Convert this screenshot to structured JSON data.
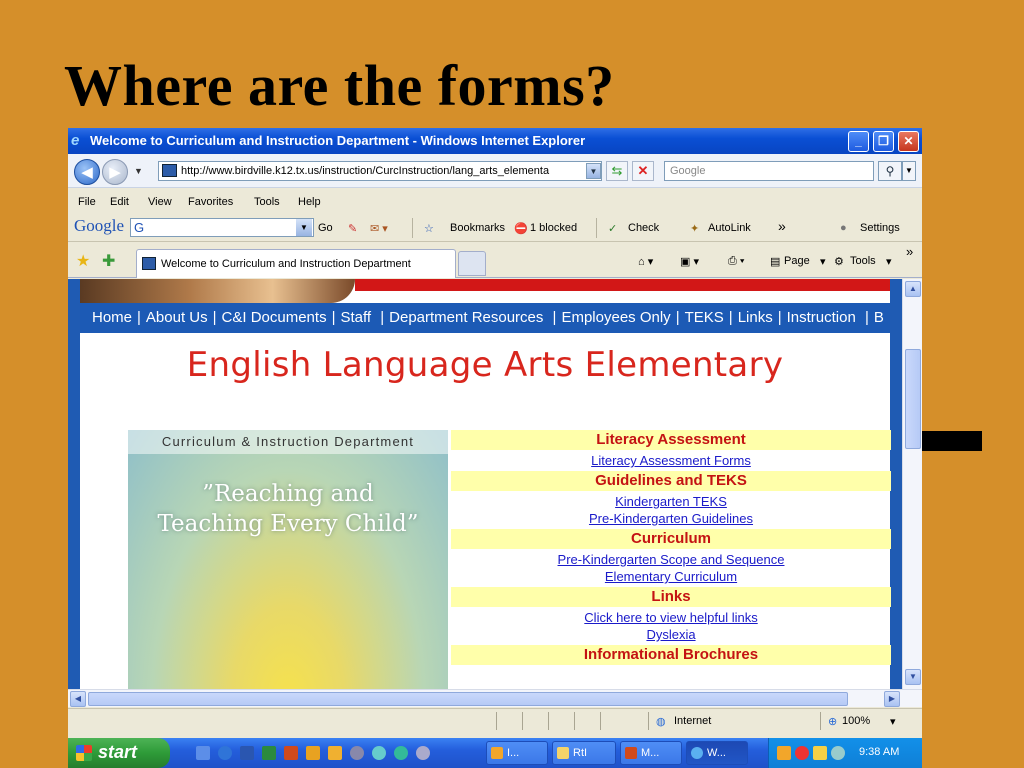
{
  "slide": {
    "title": "Where are the forms?"
  },
  "window": {
    "title": "Welcome to Curriculum and Instruction Department - Windows Internet Explorer",
    "controls": {
      "minimize": "_",
      "maximize": "❐",
      "close": "✕"
    }
  },
  "address_bar": {
    "url": "http://www.birdville.k12.tx.us/instruction/CurcInstruction/lang_arts_elementa",
    "search_placeholder": "Google"
  },
  "menu": [
    "File",
    "Edit",
    "View",
    "Favorites",
    "Tools",
    "Help"
  ],
  "google_toolbar": {
    "logo": "Google",
    "search_value": "G",
    "go": "Go",
    "bookmarks": "Bookmarks",
    "blocked": "1 blocked",
    "check": "Check",
    "autolink": "AutoLink",
    "more": "»",
    "settings": "Settings"
  },
  "tabs": {
    "active_tab": "Welcome to Curriculum and Instruction Department",
    "command_page": "Page",
    "command_tools": "Tools",
    "more": "»"
  },
  "site": {
    "nav": [
      "Home",
      "About Us",
      "C&I Documents",
      "Staff",
      "Department Resources",
      "Employees Only",
      "TEKS",
      "Links",
      "Instruction",
      "B"
    ],
    "heading": "English Language Arts Elementary",
    "picture_header": "Curriculum & Instruction Department",
    "picture_quote_line1": "”Reaching and",
    "picture_quote_line2": "Teaching Every Child”",
    "sections": [
      {
        "heading": "Literacy Assessment",
        "links": [
          "Literacy Assessment Forms"
        ]
      },
      {
        "heading": "Guidelines and TEKS",
        "links": [
          "Kindergarten TEKS",
          "Pre-Kindergarten Guidelines"
        ]
      },
      {
        "heading": "Curriculum",
        "links": [
          "Pre-Kindergarten Scope and Sequence",
          "Elementary Curriculum"
        ]
      },
      {
        "heading": "Links",
        "links": [
          "Click here to view helpful links",
          "Dyslexia"
        ]
      },
      {
        "heading": "Informational Brochures",
        "links": []
      }
    ]
  },
  "status_bar": {
    "zone": "Internet",
    "zoom": "100%"
  },
  "taskbar": {
    "start": "start",
    "buttons": [
      "I...",
      "RtI",
      "M...",
      "W..."
    ],
    "clock": "9:38 AM"
  },
  "colors": {
    "slide_background": "#D58F2A",
    "site_nav_blue": "#1C5AB5",
    "section_heading_red": "#C41313",
    "section_heading_bg": "#FFFFAA",
    "link_blue": "#1A1AC9"
  }
}
